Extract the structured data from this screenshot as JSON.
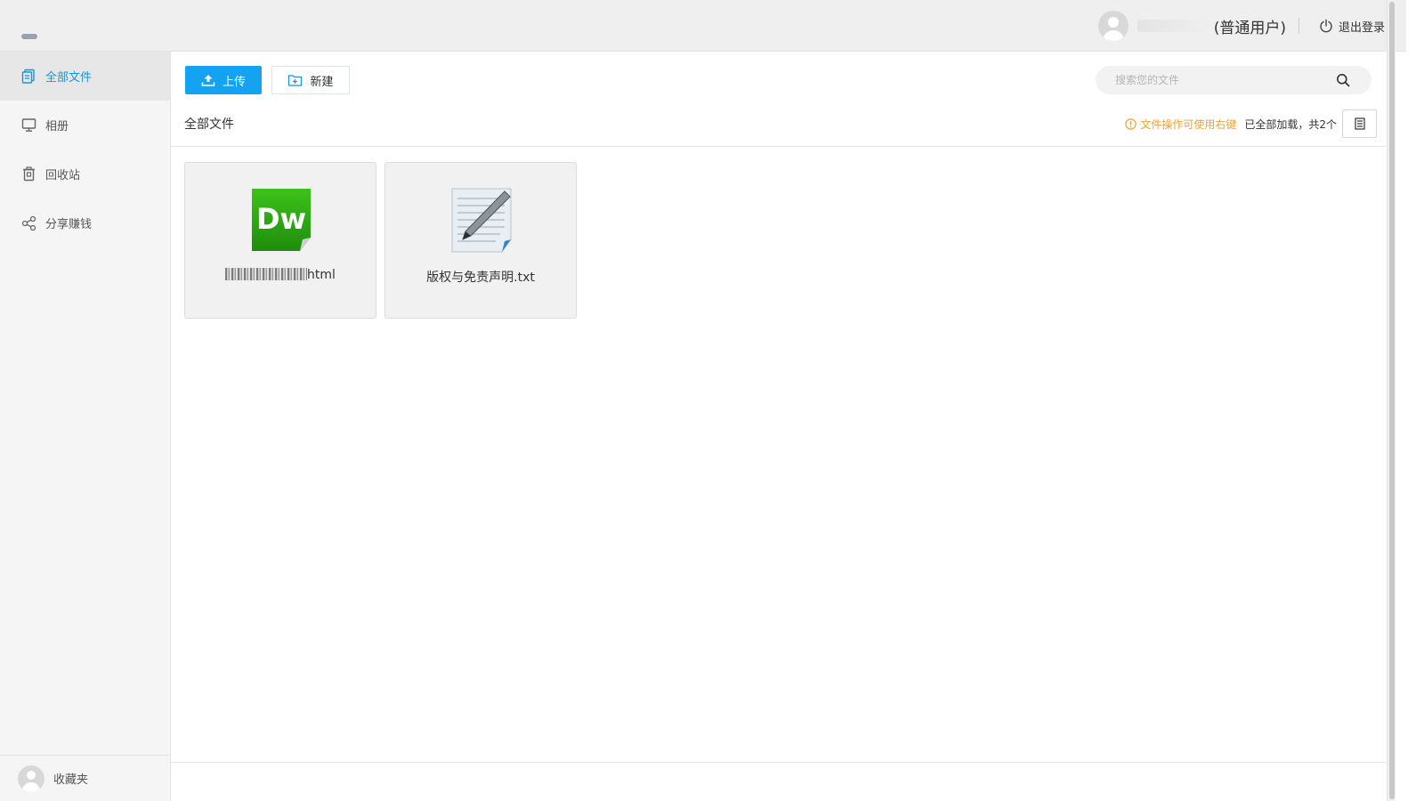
{
  "header": {
    "user_role": "(普通用户)",
    "logout_label": "退出登录"
  },
  "sidebar": {
    "items": [
      {
        "label": "全部文件",
        "icon": "files-icon",
        "active": true
      },
      {
        "label": "相册",
        "icon": "monitor-icon",
        "active": false
      },
      {
        "label": "回收站",
        "icon": "trash-icon",
        "active": false
      },
      {
        "label": "分享赚钱",
        "icon": "share-icon",
        "active": false
      }
    ],
    "bottom_label": "收藏夹"
  },
  "toolbar": {
    "upload_label": "上传",
    "new_label": "新建"
  },
  "search": {
    "placeholder": "搜索您的文件"
  },
  "subbar": {
    "breadcrumb": "全部文件",
    "tip": "文件操作可使用右键",
    "count": "已全部加载，共2个"
  },
  "files": [
    {
      "name_suffix": "html",
      "icon": "dreamweaver-file-icon"
    },
    {
      "name": "版权与免责声明.txt",
      "icon": "text-file-icon"
    }
  ],
  "colors": {
    "accent": "#13a3f2",
    "active_nav": "#1596d9",
    "tip": "#e8a23c"
  }
}
